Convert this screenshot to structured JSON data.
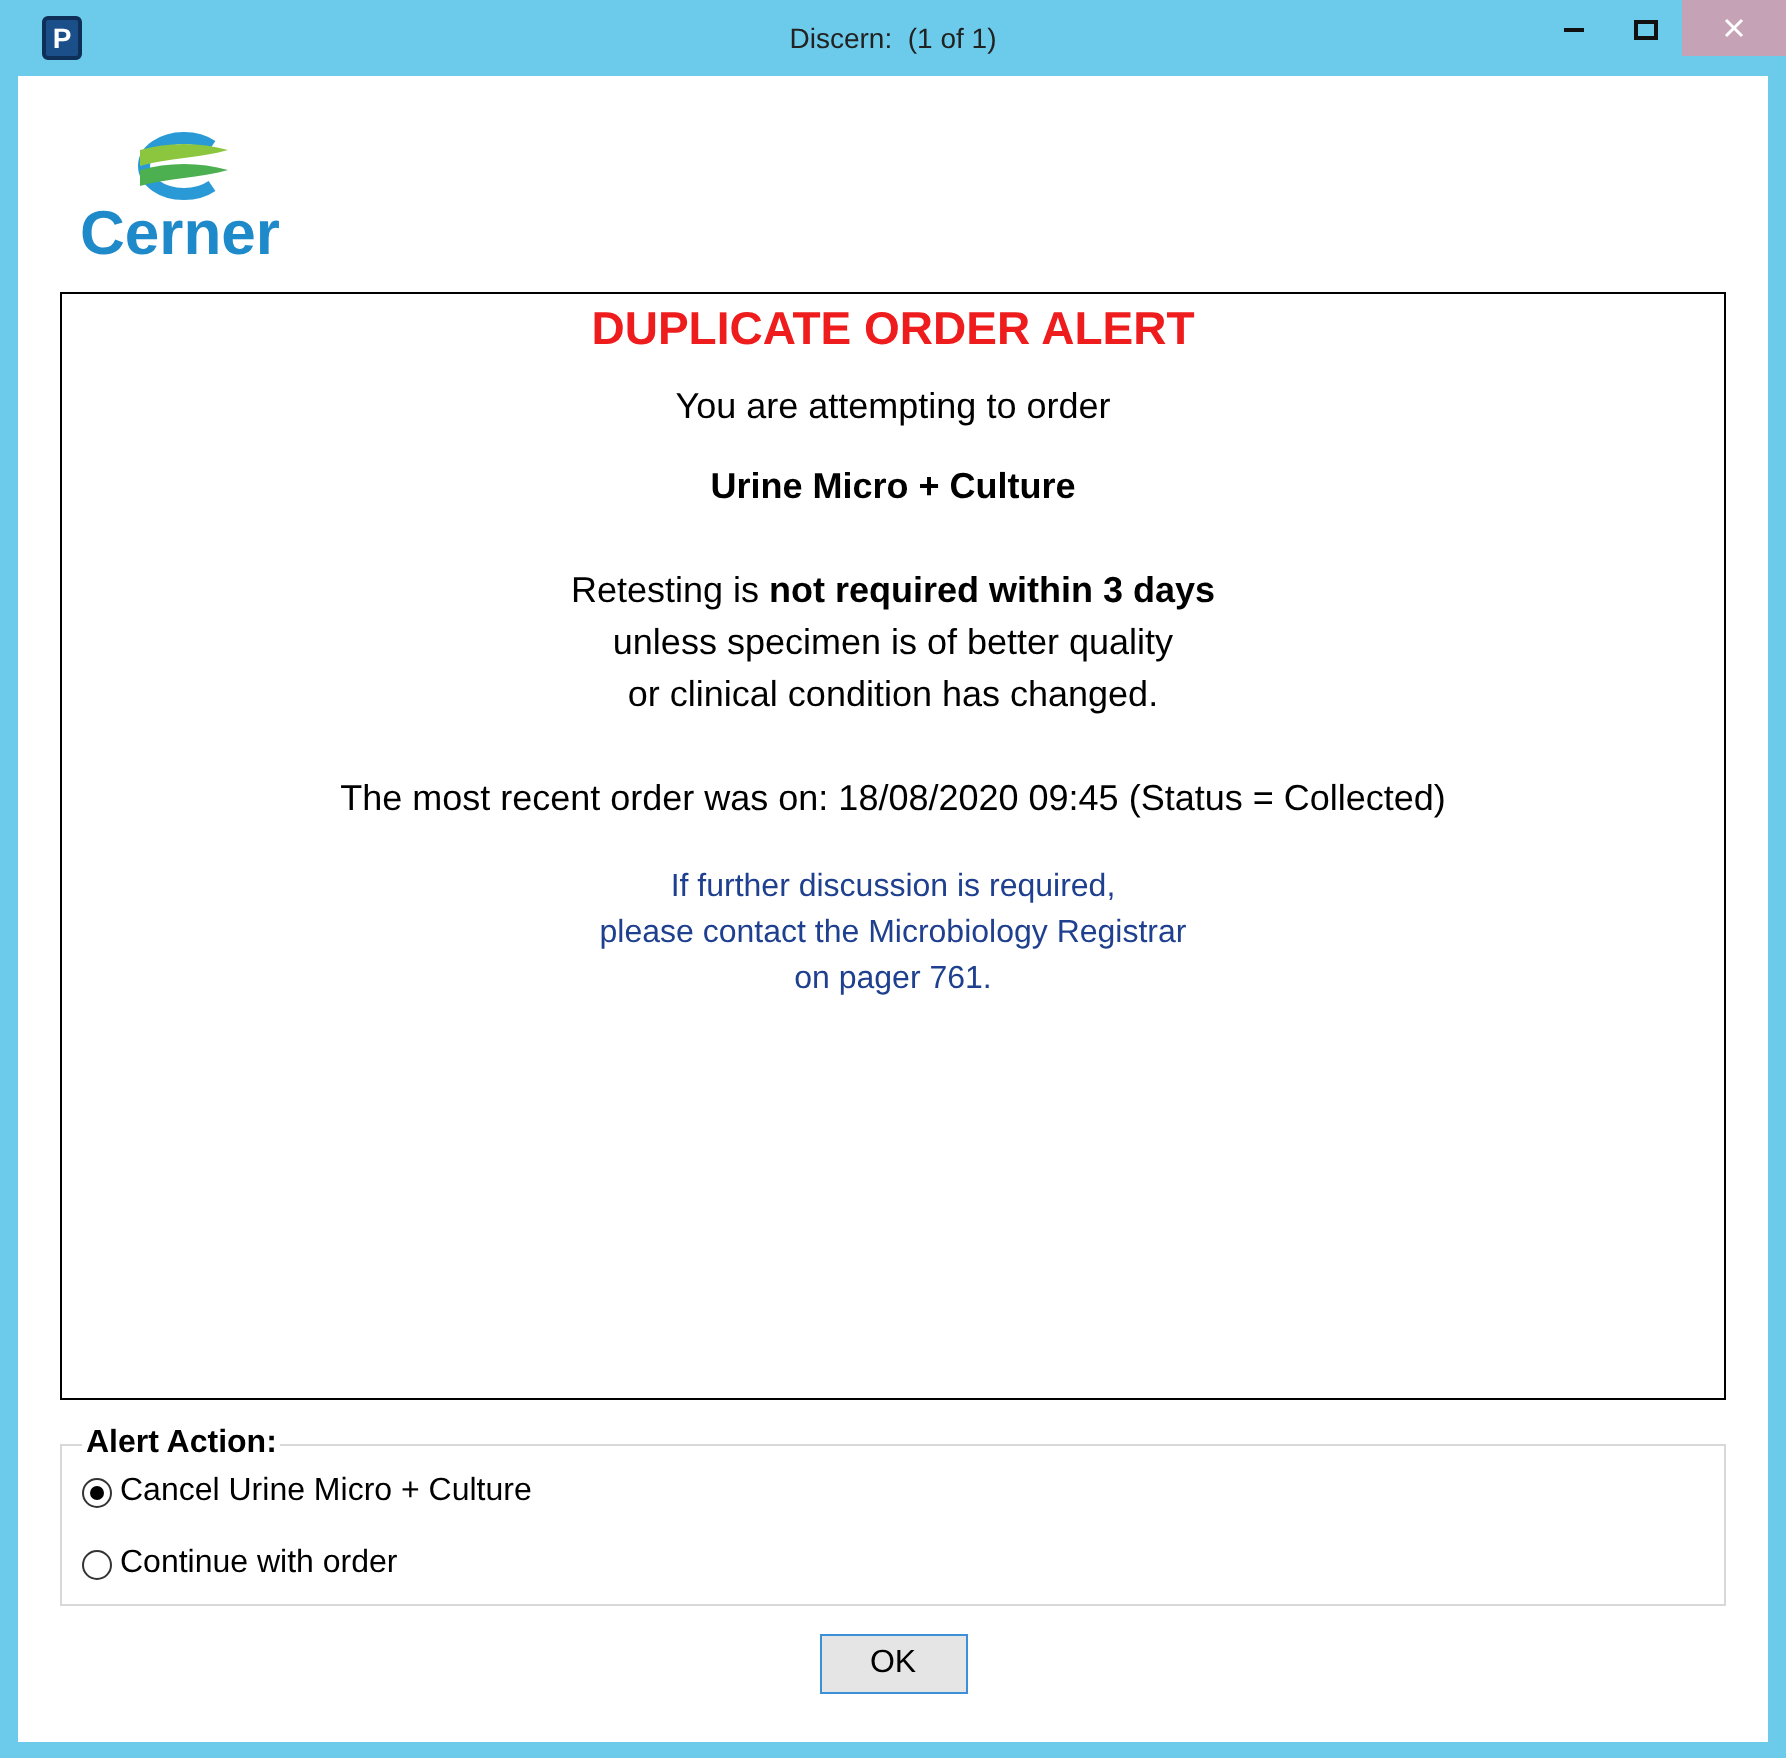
{
  "window": {
    "title": "Discern:  (1 of 1)",
    "app_icon": "P"
  },
  "logo": {
    "text": "Cerner"
  },
  "alert": {
    "title": "DUPLICATE ORDER ALERT",
    "paragraphs": [
      {
        "kind": "plain",
        "lines": [
          "You are attempting to order"
        ]
      },
      {
        "kind": "bold",
        "lines": [
          "Urine Micro + Culture"
        ]
      },
      {
        "kind": "plain",
        "lines": [
          "Retesting is **not required within 3 days**",
          "unless specimen is of better quality",
          "or clinical condition has changed."
        ]
      },
      {
        "kind": "plain",
        "lines": [
          "The most recent order was on: 18/08/2020 09:45 (Status = Collected)"
        ]
      },
      {
        "kind": "note",
        "lines": [
          "If further discussion is required,",
          "please contact the Microbiology Registrar",
          "on pager 761."
        ]
      }
    ]
  },
  "alert_action": {
    "legend": "Alert Action:",
    "options": [
      {
        "label": "Cancel Urine Micro + Culture",
        "selected": true
      },
      {
        "label": "Continue with order",
        "selected": false
      }
    ]
  },
  "buttons": [
    "OK"
  ]
}
